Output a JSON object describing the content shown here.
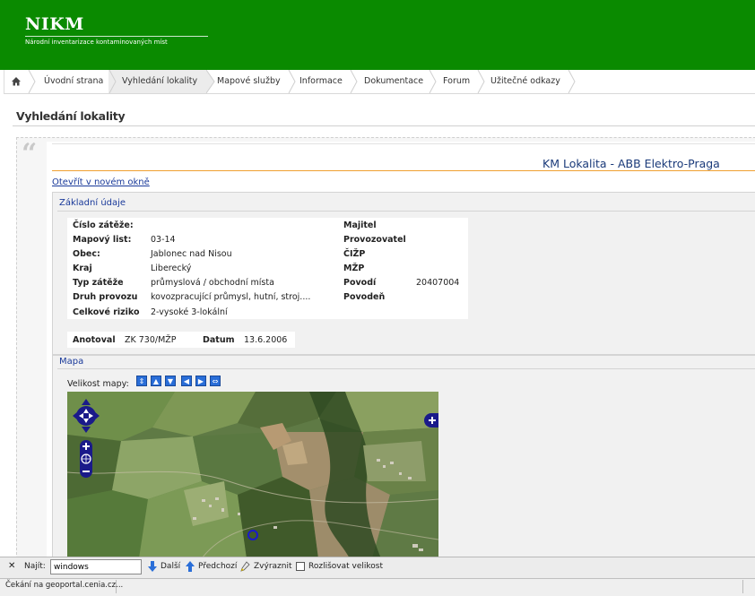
{
  "header": {
    "brand": "NIKM",
    "subtitle": "Národní inventarizace kontaminovaných míst",
    "bg_color": "#0a8a00"
  },
  "nav": {
    "home_icon": "home-icon",
    "items": [
      {
        "label": "Úvodní strana"
      },
      {
        "label": "Vyhledání lokality",
        "active": true
      },
      {
        "label": "Mapové služby"
      },
      {
        "label": "Informace"
      },
      {
        "label": "Dokumentace"
      },
      {
        "label": "Forum"
      },
      {
        "label": "Užitečné odkazy"
      }
    ]
  },
  "page": {
    "title": "Vyhledání lokality",
    "quote_glyph": "“"
  },
  "locality": {
    "title": "KM Lokalita - ABB Elektro-Praga",
    "open_new_window": "Otevřít v novém okně",
    "basic_section": "Základní údaje",
    "fields_left": [
      {
        "label": "Číslo zátěže:",
        "value": ""
      },
      {
        "label": "Mapový list:",
        "value": "03-14"
      },
      {
        "label": "Obec:",
        "value": "Jablonec nad Nisou"
      },
      {
        "label": "Kraj",
        "value": "Liberecký"
      },
      {
        "label": "Typ zátěže",
        "value": "průmyslová / obchodní místa"
      },
      {
        "label": "Druh provozu",
        "value": "kovozpracující průmysl, hutní, stroj...."
      },
      {
        "label": "Celkové riziko",
        "value": "2-vysoké 3-lokální"
      }
    ],
    "fields_right": [
      {
        "label": "Majitel",
        "value": ""
      },
      {
        "label": "Provozovatel",
        "value": ""
      },
      {
        "label": "ČIŽP",
        "value": ""
      },
      {
        "label": "MŽP",
        "value": ""
      },
      {
        "label": "Povodí",
        "value": "20407004"
      },
      {
        "label": "Povodeň",
        "value": ""
      }
    ],
    "anotoval_label": "Anotoval",
    "anotoval_value": "ZK 730/MŽP",
    "datum_label": "Datum",
    "datum_value": "13.6.2006",
    "map_section": "Mapa",
    "map_size_label": "Velikost mapy:"
  },
  "findbar": {
    "close_glyph": "✕",
    "find_label": "Najít:",
    "query": "windows",
    "next_label": "Další",
    "prev_label": "Předchozí",
    "highlight_label": "Zvýraznit",
    "match_case_label": "Rozlišovat velikost",
    "match_case_checked": false
  },
  "status": {
    "text": "Čekání na geoportal.cenia.cz..."
  }
}
